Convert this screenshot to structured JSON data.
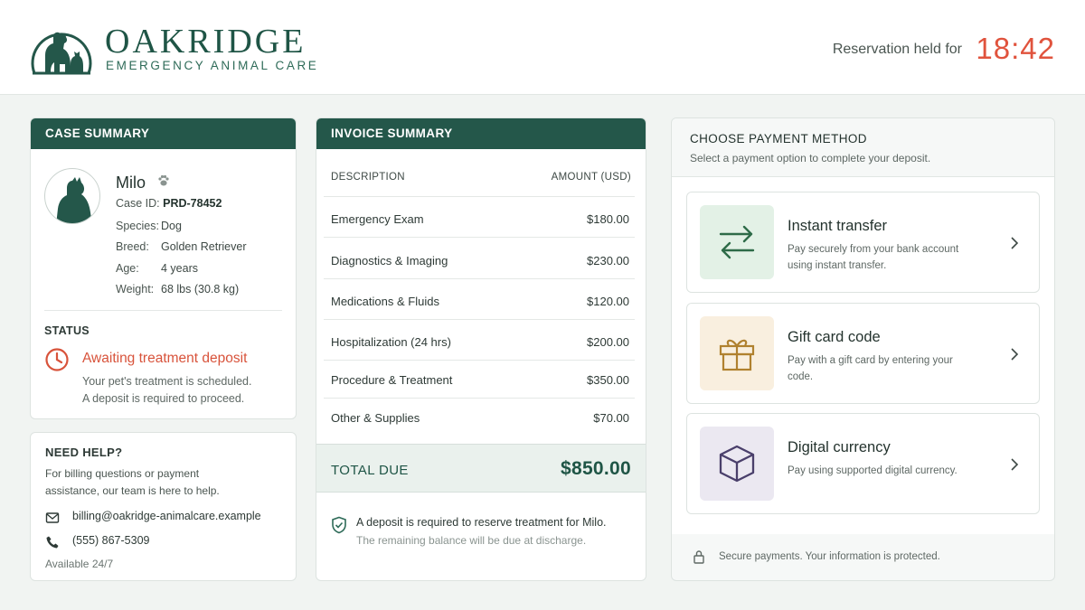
{
  "brand": {
    "name": "OAKRIDGE",
    "tagline": "EMERGENCY ANIMAL CARE"
  },
  "reservation": {
    "label": "Reservation held for",
    "timer": "18:42"
  },
  "case_summary": {
    "header": "CASE SUMMARY",
    "pet_name": "Milo",
    "case_id_label": "Case ID:",
    "case_id": "PRD-78452",
    "fields": [
      {
        "label": "Species:",
        "value": "Dog"
      },
      {
        "label": "Breed:",
        "value": "Golden Retriever"
      },
      {
        "label": "Age:",
        "value": "4 years"
      },
      {
        "label": "Weight:",
        "value": "68 lbs (30.8 kg)"
      }
    ],
    "status_label": "STATUS",
    "status_title": "Awaiting treatment deposit",
    "status_line1": "Your pet's treatment is scheduled.",
    "status_line2": "A deposit is required to proceed."
  },
  "help": {
    "title": "NEED HELP?",
    "description": "For billing questions or payment assistance, our team is here to help.",
    "email": "billing@oakridge-animalcare.example",
    "phone": "(555) 867-5309",
    "availability": "Available 24/7"
  },
  "invoice": {
    "header": "INVOICE SUMMARY",
    "col_description": "DESCRIPTION",
    "col_amount": "AMOUNT (USD)",
    "items": [
      {
        "description": "Emergency Exam",
        "amount": "$180.00"
      },
      {
        "description": "Diagnostics & Imaging",
        "amount": "$230.00"
      },
      {
        "description": "Medications & Fluids",
        "amount": "$120.00"
      },
      {
        "description": "Hospitalization (24 hrs)",
        "amount": "$200.00"
      },
      {
        "description": "Procedure & Treatment",
        "amount": "$350.00"
      },
      {
        "description": "Other & Supplies",
        "amount": "$70.00"
      }
    ],
    "total_label": "TOTAL DUE",
    "total_amount": "$850.00",
    "deposit_note": "A deposit is required to reserve treatment for Milo.",
    "balance_note": "The remaining balance will be due at discharge."
  },
  "payment": {
    "title": "CHOOSE PAYMENT METHOD",
    "subtitle": "Select a payment option to complete your deposit.",
    "options": [
      {
        "title": "Instant transfer",
        "description": "Pay securely from your bank account using instant transfer.",
        "icon": "transfer-arrows-icon",
        "tint": "#e3f1e6",
        "color": "#2e6b48"
      },
      {
        "title": "Gift card code",
        "description": "Pay with a gift card by entering your code.",
        "icon": "gift-icon",
        "tint": "#f9efdf",
        "color": "#b0812f"
      },
      {
        "title": "Digital currency",
        "description": "Pay using supported digital currency.",
        "icon": "cube-icon",
        "tint": "#ebe8f1",
        "color": "#4a3f6b"
      }
    ],
    "secure_note": "Secure payments. Your information is protected."
  },
  "colors": {
    "brand": "#24574a",
    "alert": "#e0533d",
    "background": "#f1f4f2"
  }
}
